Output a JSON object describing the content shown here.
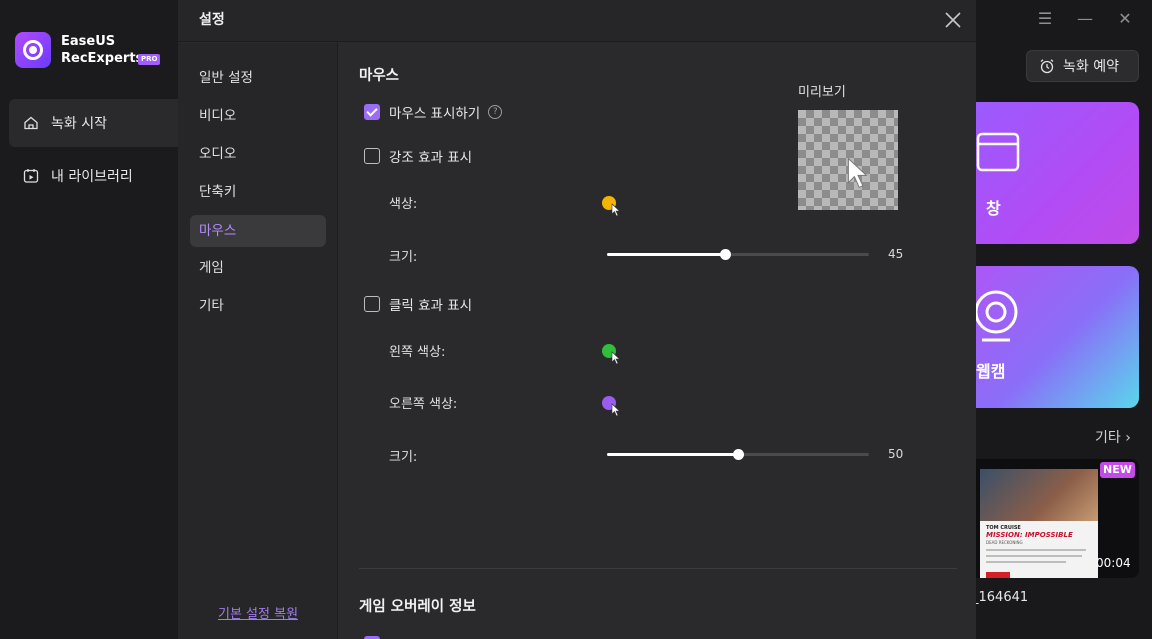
{
  "app": {
    "brand_line1": "EaseUS",
    "brand_line2": "RecExperts",
    "pro_badge": "PRO",
    "nav": [
      {
        "label": "녹화 시작",
        "icon": "home-icon",
        "active": true
      },
      {
        "label": "내 라이브러리",
        "icon": "library-icon",
        "active": false
      }
    ],
    "schedule_button": "녹화 예약",
    "cards": [
      {
        "label": "창",
        "icon": "window-icon"
      },
      {
        "label": "웹캠",
        "icon": "webcam-icon"
      }
    ],
    "other_link": "기타",
    "recent": {
      "badge": "NEW",
      "duration": "00:04",
      "filename": "_164641",
      "thumb_text1": "TOM CRUISE",
      "thumb_text2": "MISSION: IMPOSSIBLE",
      "thumb_text3": "DEAD RECKONING"
    }
  },
  "dialog": {
    "title": "설정",
    "nav": [
      {
        "label": "일반 설정",
        "active": false
      },
      {
        "label": "비디오",
        "active": false
      },
      {
        "label": "오디오",
        "active": false
      },
      {
        "label": "단축키",
        "active": false
      },
      {
        "label": "마우스",
        "active": true
      },
      {
        "label": "게임",
        "active": false
      },
      {
        "label": "기타",
        "active": false
      }
    ],
    "reset_link": "기본 설정 복원",
    "mouse": {
      "section_title": "마우스",
      "show_mouse": {
        "label": "마우스 표시하기",
        "checked": true
      },
      "highlight": {
        "label": "강조 효과 표시",
        "checked": false
      },
      "highlight_color_label": "색상:",
      "highlight_color": "#f5b400",
      "highlight_size_label": "크기:",
      "highlight_size": 45,
      "click": {
        "label": "클릭 효과 표시",
        "checked": false
      },
      "left_color_label": "왼쪽 색상:",
      "left_color": "#2fbf3a",
      "right_color_label": "오른쪽 색상:",
      "right_color": "#9b5cf0",
      "click_size_label": "크기:",
      "click_size": 50,
      "preview_label": "미리보기"
    },
    "game_overlay": {
      "section_title": "게임 오버레이 정보"
    }
  }
}
